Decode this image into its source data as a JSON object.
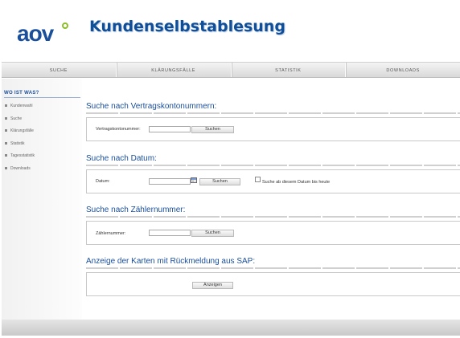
{
  "header": {
    "logo_text": "aov",
    "title": "Kundenselbstablesung"
  },
  "nav": [
    {
      "label": "SUCHE"
    },
    {
      "label": "KLÄRUNGSFÄLLE"
    },
    {
      "label": "STATISTIK"
    },
    {
      "label": "DOWNLOADS"
    }
  ],
  "sidebar": {
    "heading": "WO IST WAS?",
    "items": [
      {
        "label": "Kundenwahl"
      },
      {
        "label": "Suche"
      },
      {
        "label": "Klärungsfälle"
      },
      {
        "label": "Statistik"
      },
      {
        "label": "Tagesstatistik"
      },
      {
        "label": "Downloads"
      }
    ]
  },
  "sections": {
    "vertrag": {
      "title": "Suche nach Vertragskontonummern:",
      "field_label": "Vertragskontonummer:",
      "value": "",
      "button": "Suchen"
    },
    "datum": {
      "title": "Suche nach Datum:",
      "field_label": "Datum:",
      "value": "",
      "button": "Suchen",
      "checkbox_label": "Suche ab diesem Datum bis heute",
      "checkbox_checked": false
    },
    "zaehler": {
      "title": "Suche nach Zählernummer:",
      "field_label": "Zählernummer:",
      "value": "",
      "button": "Suchen"
    },
    "karten": {
      "title": "Anzeige der Karten mit Rückmeldung aus SAP:",
      "button": "Anzeigen"
    }
  },
  "colors": {
    "brand_blue": "#1a4f9c",
    "logo_accent_green": "#8cbf26"
  }
}
